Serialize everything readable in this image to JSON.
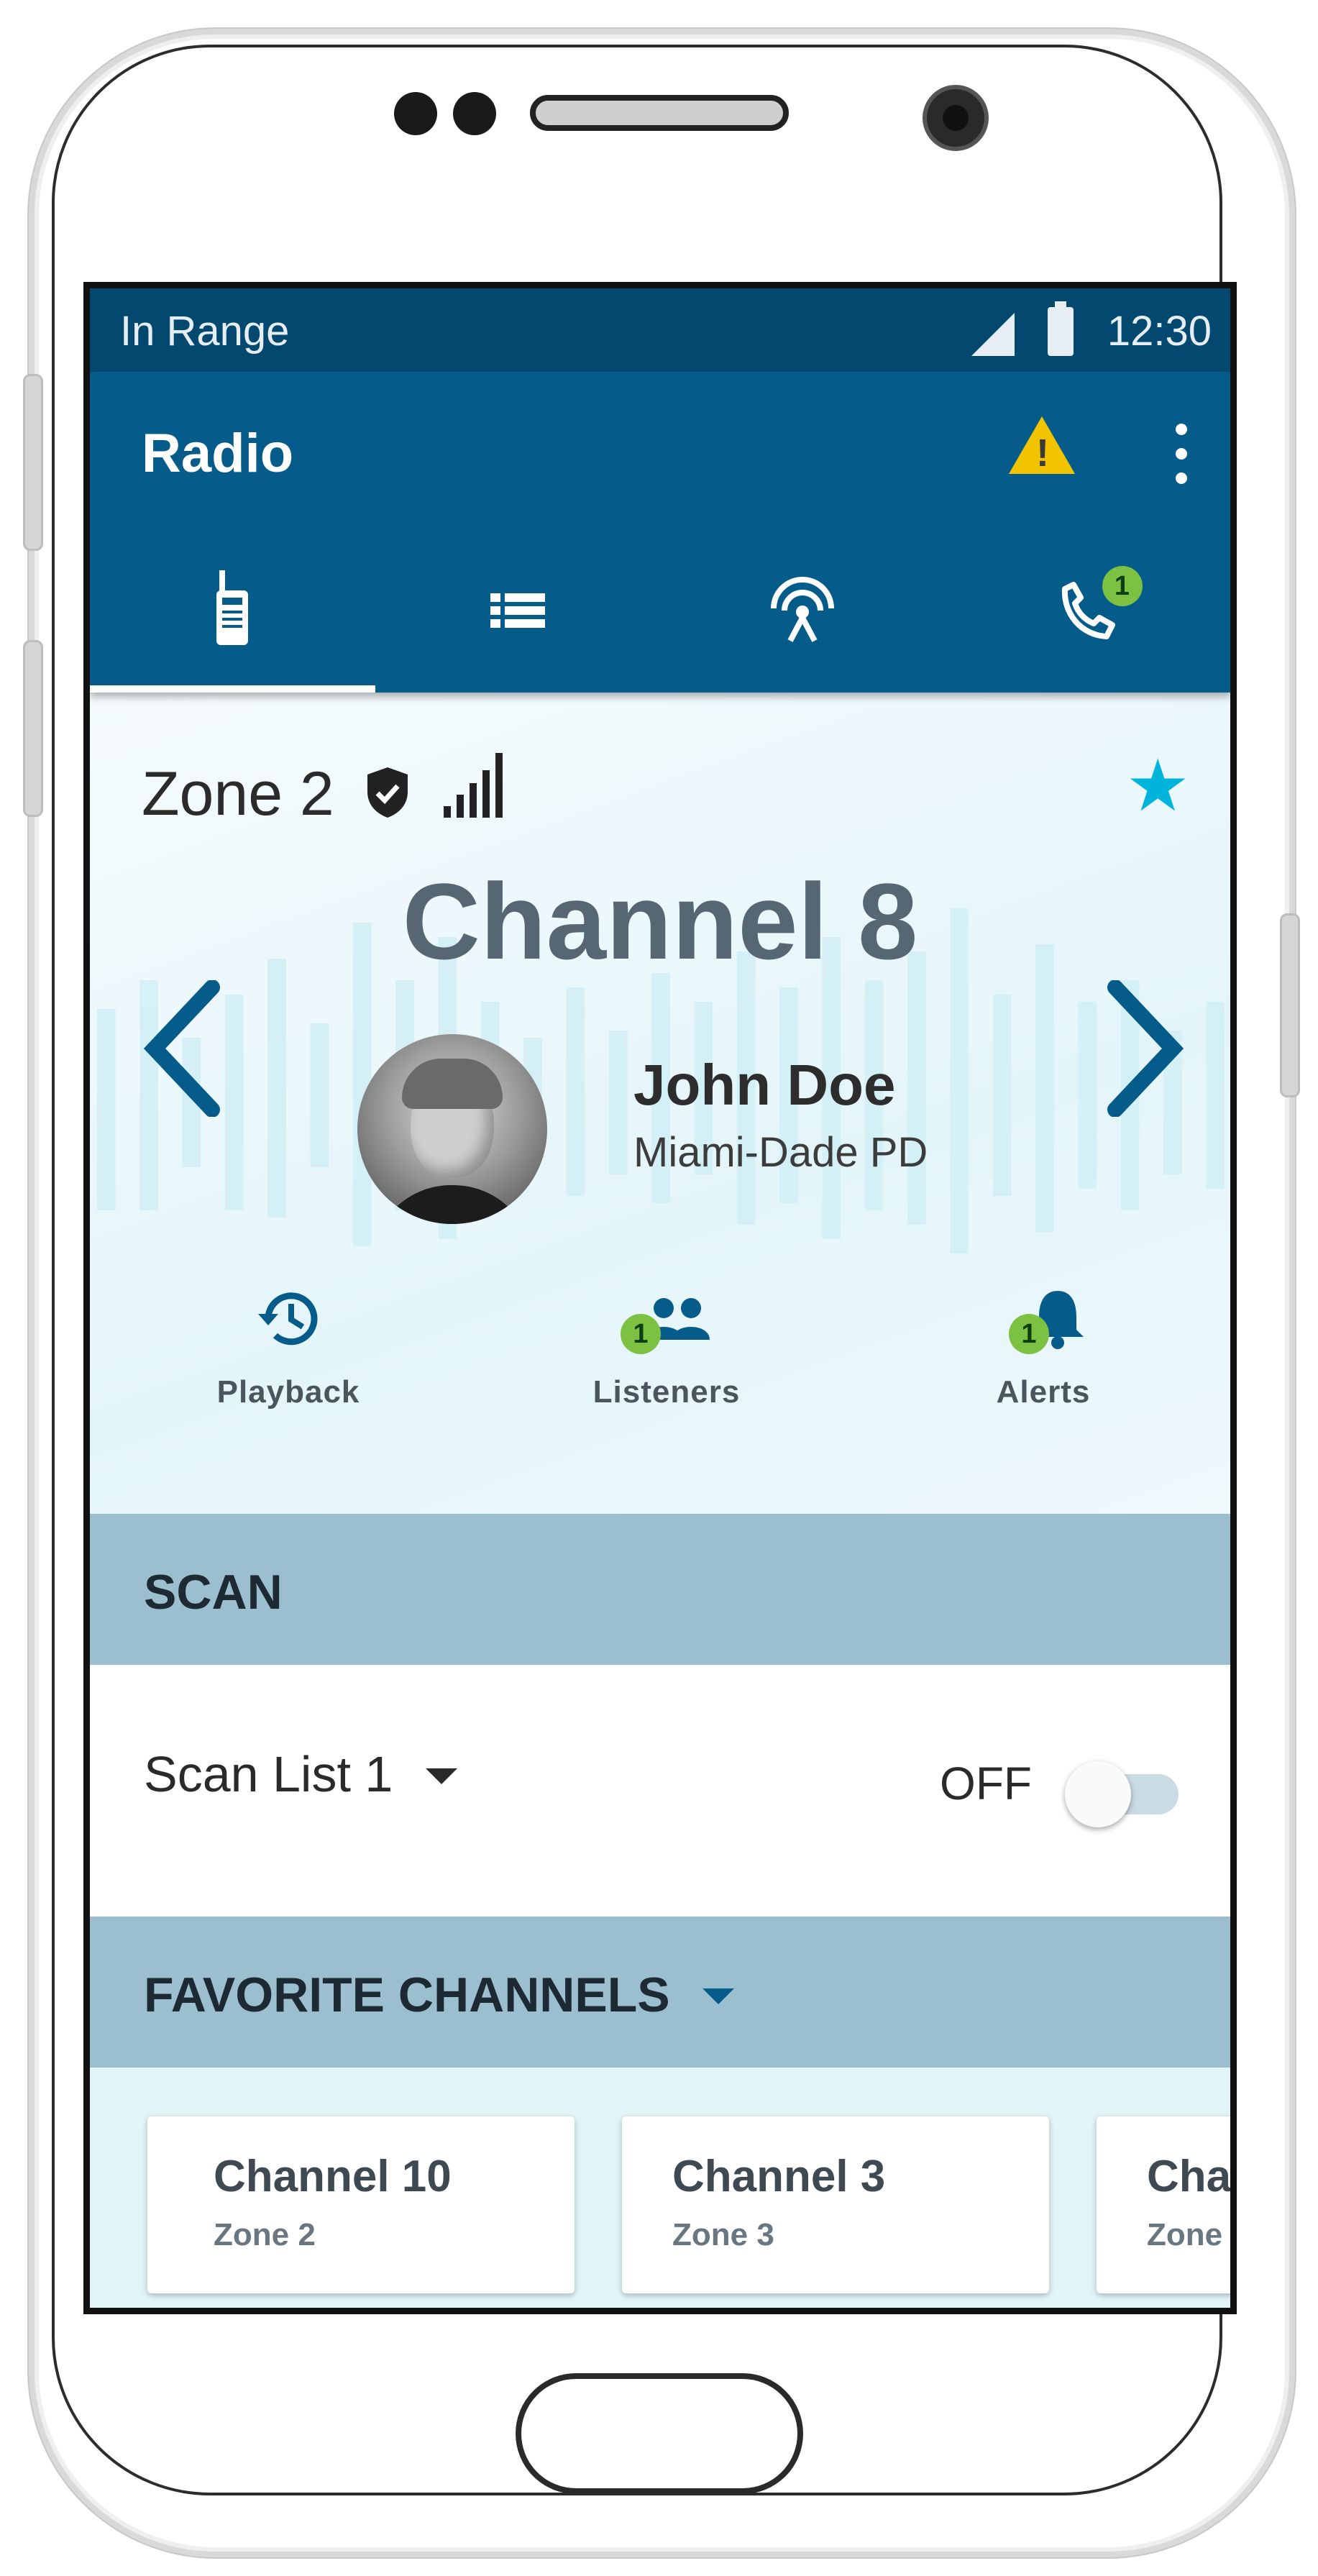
{
  "status_bar": {
    "range": "In Range",
    "time": "12:30"
  },
  "app_bar": {
    "title": "Radio"
  },
  "tabs": [
    {
      "name": "radio"
    },
    {
      "name": "channel-list"
    },
    {
      "name": "broadcast"
    },
    {
      "name": "calls",
      "badge": "1"
    }
  ],
  "channel": {
    "zone": "Zone 2",
    "name": "Channel 8",
    "speaker_name": "John Doe",
    "speaker_agency": "Miami-Dade PD"
  },
  "actions": {
    "playback": "Playback",
    "listeners": "Listeners",
    "listeners_badge": "1",
    "alerts": "Alerts",
    "alerts_badge": "1"
  },
  "scan": {
    "header": "SCAN",
    "list": "Scan List 1",
    "toggle_state": "OFF"
  },
  "favorites": {
    "header": "FAVORITE CHANNELS",
    "cards": [
      {
        "channel": "Channel 10",
        "zone": "Zone 2"
      },
      {
        "channel": "Channel 3",
        "zone": "Zone 3"
      },
      {
        "channel": "Cha",
        "zone": "Zone"
      }
    ]
  },
  "colors": {
    "status_bar": "#03486e",
    "app_bar": "#055c8a",
    "accent_star": "#00b4dc",
    "section_header": "#9bbfcf",
    "badge": "#7cc142",
    "warning": "#f2c400"
  }
}
